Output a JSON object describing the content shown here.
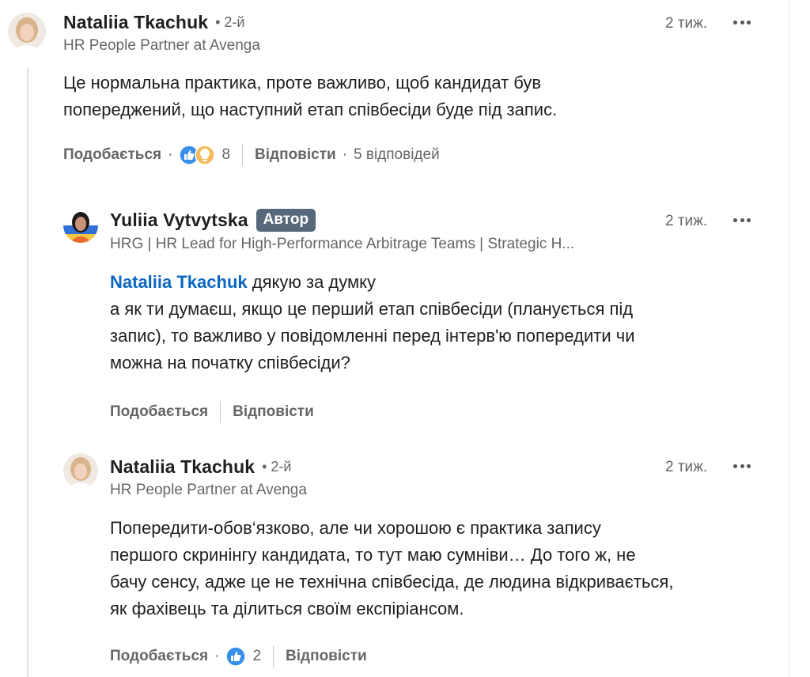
{
  "comments": [
    {
      "author": "Nataliia Tkachuk",
      "degree": "• 2-й",
      "headline": "HR People Partner at Avenga",
      "time": "2 тиж.",
      "lines": [
        "Це нормальна практика, проте важливо, щоб кандидат був",
        "попереджений, що наступний етап співбесіди буде під запис."
      ],
      "like_label": "Подобається",
      "reaction_count": "8",
      "reply_label": "Відповісти",
      "replies_count": "5 відповідей"
    },
    {
      "author": "Yuliia Vytvytska",
      "badge": "Автор",
      "headline": "HRG | HR Lead for High-Performance Arbitrage Teams | Strategic H...",
      "time": "2 тиж.",
      "mention": "Nataliia Tkachuk",
      "first_line_rest": " дякую за думку",
      "lines": [
        "а як ти думаєш, якщо це перший етап співбесіди (планується під",
        "запис), то важливо у повідомленні перед інтерв'ю попередити чи",
        "можна на початку співбесіди?"
      ],
      "like_label": "Подобається",
      "reply_label": "Відповісти"
    },
    {
      "author": "Nataliia Tkachuk",
      "degree": "• 2-й",
      "headline": "HR People Partner at Avenga",
      "time": "2 тиж.",
      "lines": [
        "Попередити-обов‘язково, але чи хорошою є практика запису",
        "першого скринінгу кандидата, то тут маю сумніви… До того ж, не",
        "бачу сенсу, адже це не технічна співбесіда, де людина відкривається,",
        "як фахівець та ділиться своїм експіріансом."
      ],
      "like_label": "Подобається",
      "reaction_count": "2",
      "reply_label": "Відповісти"
    }
  ],
  "icons": [
    "avatar-photo",
    "more-horizontal-icon",
    "like-reaction-icon",
    "insightful-reaction-icon"
  ],
  "colors": {
    "mention": "#0a66c2",
    "badge_bg": "#56687a",
    "like_blue": "#378fe9",
    "insight_yellow": "#f5bb5c"
  }
}
